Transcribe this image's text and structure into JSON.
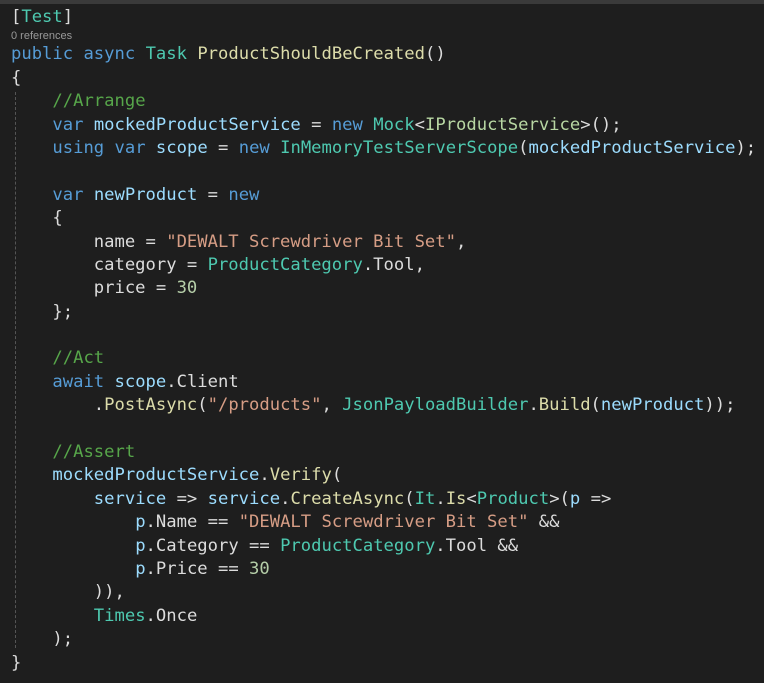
{
  "editor": {
    "codelens": "0 references",
    "lines": [
      [
        [
          "[",
          "p"
        ],
        [
          "Test",
          "t"
        ],
        [
          "]",
          "p"
        ]
      ],
      "CODELENS",
      [
        [
          "public",
          "k"
        ],
        [
          " ",
          "p"
        ],
        [
          "async",
          "k"
        ],
        [
          " ",
          "p"
        ],
        [
          "Task",
          "t"
        ],
        [
          " ",
          "p"
        ],
        [
          "ProductShouldBeCreated",
          "m"
        ],
        [
          "()",
          "p"
        ]
      ],
      [
        [
          "{",
          "p"
        ]
      ],
      [
        [
          "    ",
          "p"
        ],
        [
          "//Arrange",
          "c"
        ]
      ],
      [
        [
          "    ",
          "p"
        ],
        [
          "var",
          "k"
        ],
        [
          " ",
          "p"
        ],
        [
          "mockedProductService",
          "v"
        ],
        [
          " = ",
          "p"
        ],
        [
          "new",
          "k"
        ],
        [
          " ",
          "p"
        ],
        [
          "Mock",
          "t"
        ],
        [
          "<",
          "p"
        ],
        [
          "IProductService",
          "i"
        ],
        [
          ">();",
          "p"
        ]
      ],
      [
        [
          "    ",
          "p"
        ],
        [
          "using",
          "k"
        ],
        [
          " ",
          "p"
        ],
        [
          "var",
          "k"
        ],
        [
          " ",
          "p"
        ],
        [
          "scope",
          "v"
        ],
        [
          " = ",
          "p"
        ],
        [
          "new",
          "k"
        ],
        [
          " ",
          "p"
        ],
        [
          "InMemoryTestServerScope",
          "t"
        ],
        [
          "(",
          "p"
        ],
        [
          "mockedProductService",
          "v"
        ],
        [
          ");",
          "p"
        ]
      ],
      [],
      [
        [
          "    ",
          "p"
        ],
        [
          "var",
          "k"
        ],
        [
          " ",
          "p"
        ],
        [
          "newProduct",
          "v"
        ],
        [
          " = ",
          "p"
        ],
        [
          "new",
          "k"
        ]
      ],
      [
        [
          "    {",
          "p"
        ]
      ],
      [
        [
          "        name = ",
          "p"
        ],
        [
          "\"DEWALT Screwdriver Bit Set\"",
          "s"
        ],
        [
          ",",
          "p"
        ]
      ],
      [
        [
          "        category = ",
          "p"
        ],
        [
          "ProductCategory",
          "t"
        ],
        [
          ".Tool,",
          "p"
        ]
      ],
      [
        [
          "        price = ",
          "p"
        ],
        [
          "30",
          "n"
        ]
      ],
      [
        [
          "    };",
          "p"
        ]
      ],
      [],
      [
        [
          "    ",
          "p"
        ],
        [
          "//Act",
          "c"
        ]
      ],
      [
        [
          "    ",
          "p"
        ],
        [
          "await",
          "k"
        ],
        [
          " ",
          "p"
        ],
        [
          "scope",
          "v"
        ],
        [
          ".Client",
          "p"
        ]
      ],
      [
        [
          "        .",
          "p"
        ],
        [
          "PostAsync",
          "m"
        ],
        [
          "(",
          "p"
        ],
        [
          "\"/products\"",
          "s"
        ],
        [
          ", ",
          "p"
        ],
        [
          "JsonPayloadBuilder",
          "t"
        ],
        [
          ".",
          "p"
        ],
        [
          "Build",
          "m"
        ],
        [
          "(",
          "p"
        ],
        [
          "newProduct",
          "v"
        ],
        [
          "));",
          "p"
        ]
      ],
      [],
      [
        [
          "    ",
          "p"
        ],
        [
          "//Assert",
          "c"
        ]
      ],
      [
        [
          "    ",
          "p"
        ],
        [
          "mockedProductService",
          "v"
        ],
        [
          ".",
          "p"
        ],
        [
          "Verify",
          "m"
        ],
        [
          "(",
          "p"
        ]
      ],
      [
        [
          "        ",
          "p"
        ],
        [
          "service",
          "v"
        ],
        [
          " => ",
          "p"
        ],
        [
          "service",
          "v"
        ],
        [
          ".",
          "p"
        ],
        [
          "CreateAsync",
          "m"
        ],
        [
          "(",
          "p"
        ],
        [
          "It",
          "t"
        ],
        [
          ".",
          "p"
        ],
        [
          "Is",
          "m"
        ],
        [
          "<",
          "p"
        ],
        [
          "Product",
          "t"
        ],
        [
          ">(",
          "p"
        ],
        [
          "p",
          "v"
        ],
        [
          " =>",
          "p"
        ]
      ],
      [
        [
          "            ",
          "p"
        ],
        [
          "p",
          "v"
        ],
        [
          ".Name == ",
          "p"
        ],
        [
          "\"DEWALT Screwdriver Bit Set\"",
          "s"
        ],
        [
          " &&",
          "p"
        ]
      ],
      [
        [
          "            ",
          "p"
        ],
        [
          "p",
          "v"
        ],
        [
          ".Category == ",
          "p"
        ],
        [
          "ProductCategory",
          "t"
        ],
        [
          ".Tool &&",
          "p"
        ]
      ],
      [
        [
          "            ",
          "p"
        ],
        [
          "p",
          "v"
        ],
        [
          ".Price == ",
          "p"
        ],
        [
          "30",
          "n"
        ]
      ],
      [
        [
          "        )),",
          "p"
        ]
      ],
      [
        [
          "        ",
          "p"
        ],
        [
          "Times",
          "t"
        ],
        [
          ".Once",
          "p"
        ]
      ],
      [
        [
          "    );",
          "p"
        ]
      ],
      [
        [
          "}",
          "p"
        ]
      ]
    ]
  }
}
